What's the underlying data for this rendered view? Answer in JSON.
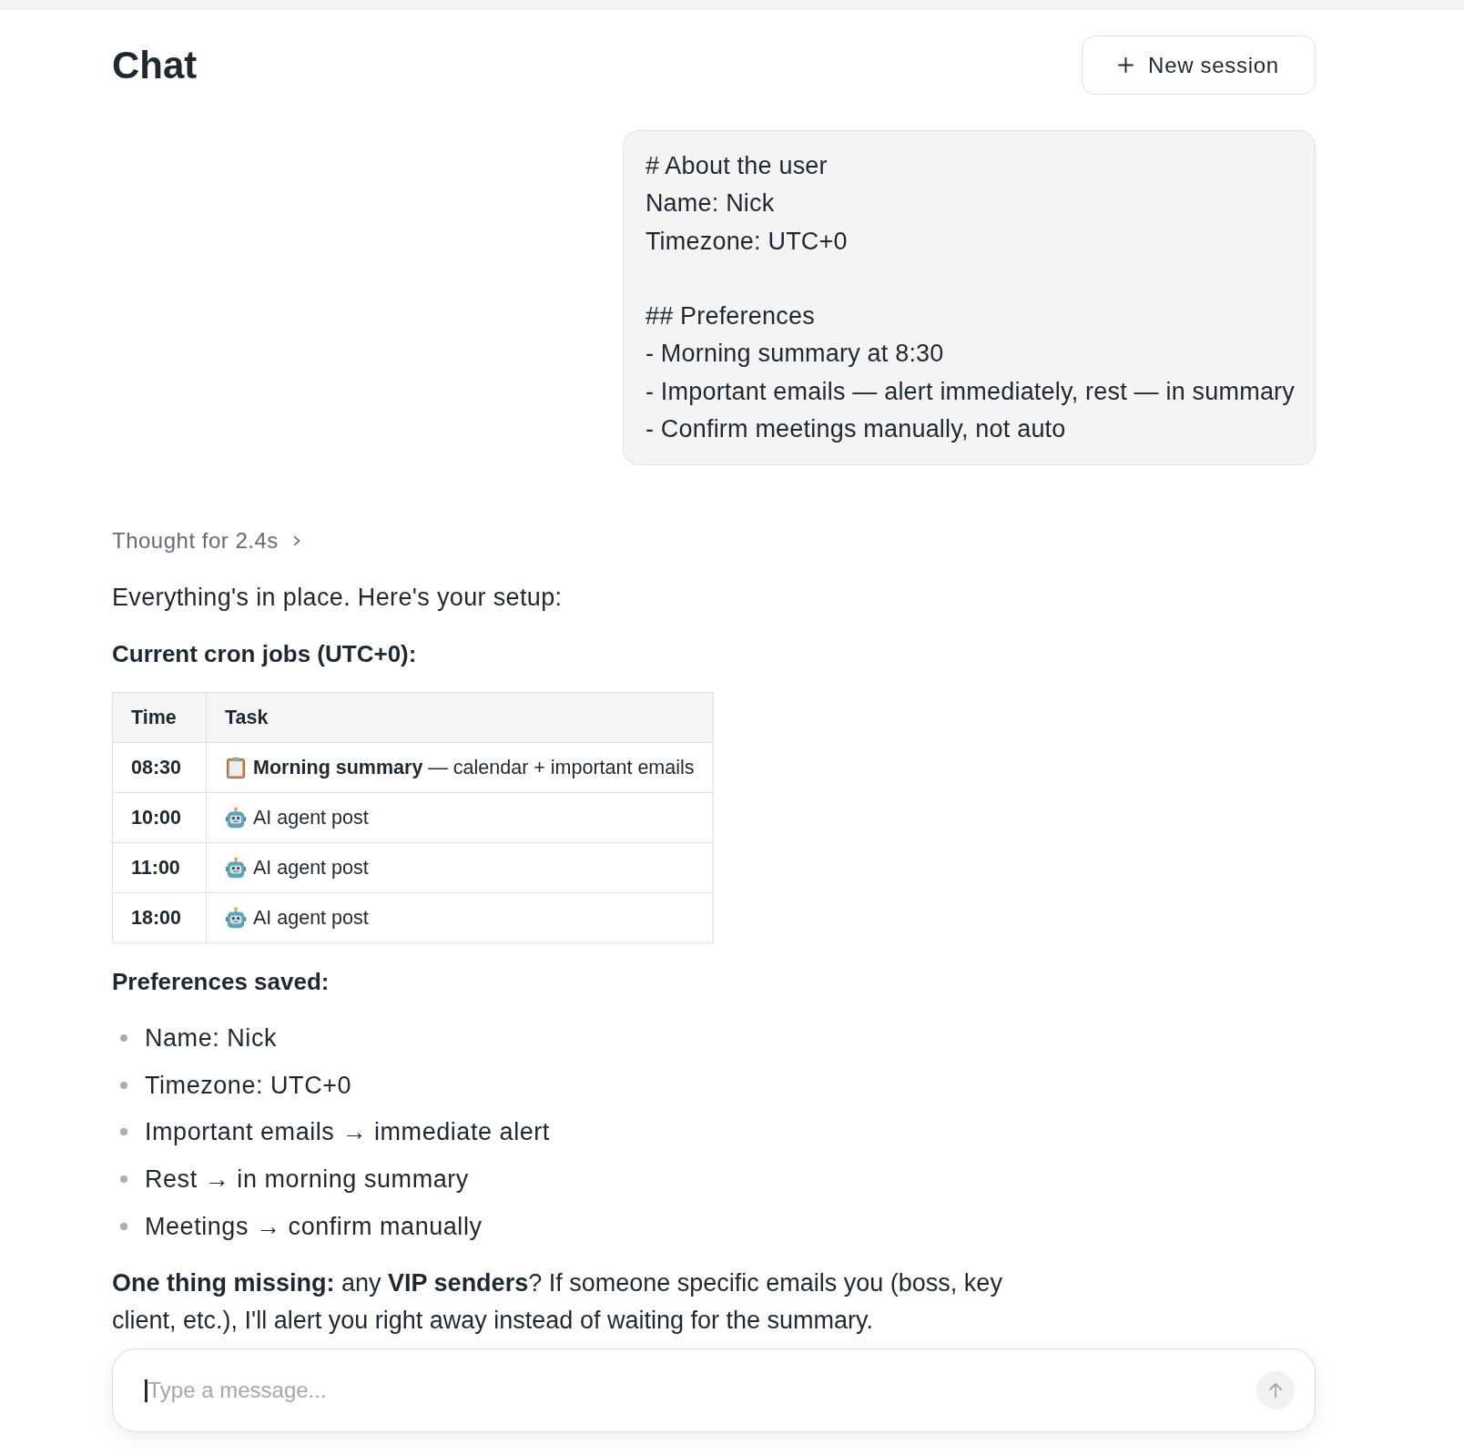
{
  "header": {
    "title": "Chat",
    "new_session_button": {
      "label": "New session"
    }
  },
  "user_message": {
    "text": "# About the user\nName: Nick\nTimezone: UTC+0\n\n## Preferences\n- Morning summary at 8:30\n- Important emails — alert immediately, rest — in summary\n- Confirm meetings manually, not auto"
  },
  "assistant_message": {
    "thought": {
      "label": "Thought for 2.4s",
      "expanded": false
    },
    "intro": "Everything's in place. Here's your setup:",
    "cron_heading": "Current cron jobs (UTC+0):",
    "cron_table": {
      "columns": [
        "Time",
        "Task"
      ],
      "rows": [
        {
          "time": "08:30",
          "kind": "clipboard",
          "task": "**Morning summary** — calendar + important emails"
        },
        {
          "time": "10:00",
          "kind": "robot",
          "task": "AI agent post"
        },
        {
          "time": "11:00",
          "kind": "robot",
          "task": "AI agent post"
        },
        {
          "time": "18:00",
          "kind": "robot",
          "task": "AI agent post"
        }
      ]
    },
    "preferences_heading": "Preferences saved:",
    "preferences": [
      "Name: Nick",
      "Timezone: UTC+0",
      "Important emails → immediate alert",
      "Rest → in morning summary",
      "Meetings → confirm manually"
    ],
    "closing": "**One thing missing:** any **VIP senders**? If someone specific emails you (boss, key client, etc.), I'll alert you right away instead of waiting for the summary."
  },
  "composer": {
    "placeholder": "Type a message...",
    "focused": true,
    "send_button": {
      "disabled": true
    }
  }
}
